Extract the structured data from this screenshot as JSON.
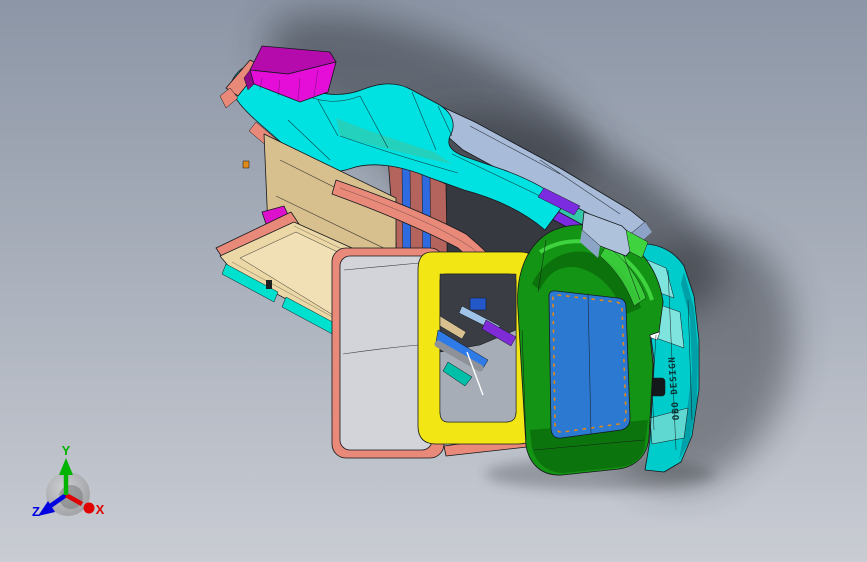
{
  "viewport": {
    "type": "cad-3d-viewport",
    "model_subject": "truck-cab body assembly"
  },
  "colors": {
    "bg_top": "#8C96A6",
    "bg_bottom": "#C9CCD3",
    "shadow": "#2E3237",
    "roof": "#00E2E2",
    "roof_teal": "#35C8A8",
    "roof_rear": "#A8BCDA",
    "cap_steel": "#AEC2DC",
    "rail_purple": "#7C2CE0",
    "rail_salmon": "#E8897A",
    "spoiler": "#E50DD8",
    "spoiler_top": "#B50AAC",
    "wedge_magenta": "#DD11CC",
    "rear_wall": "#D8C08E",
    "deck": "#ECD8A6",
    "deck_edge": "#00E0CF",
    "interior_shadow": "#36393F",
    "interior_red": "#B4645C",
    "pillar_blue": "#2E6BE0",
    "interior_lavender": "#C6C8D6",
    "door_panel": "#D2D4DA",
    "door_frame_yellow": "#F2E615",
    "opening_dark": "#3A3E44",
    "opening_light": "#A7ADB6",
    "beam_wheat": "#D8C090",
    "beam_blue": "#2E7BE8",
    "beam_lightblue": "#9FC4E8",
    "beam_purple": "#7F2BD8",
    "beam_teal": "#00BFA8",
    "beam_gray": "#8E9298",
    "front_green": "#149414",
    "front_green_dark": "#0B6E0B",
    "front_green_light": "#3FD43F",
    "windshield": "#2C79D2",
    "trim_orange": "#E08818",
    "front_cyan": "#00CCCC",
    "front_cyan_dark": "#00A0A8",
    "front_cyan_light": "#7FE4DE",
    "scratch_white": "#FFFFFF",
    "text_dark": "#0A3234",
    "axis_x": "#E00000",
    "axis_y": "#00B400",
    "axis_z": "#0000E0"
  },
  "model": {
    "branding_text": "OBO DESIGN"
  },
  "triad": {
    "x_label": "X",
    "y_label": "Y",
    "z_label": "Z"
  }
}
